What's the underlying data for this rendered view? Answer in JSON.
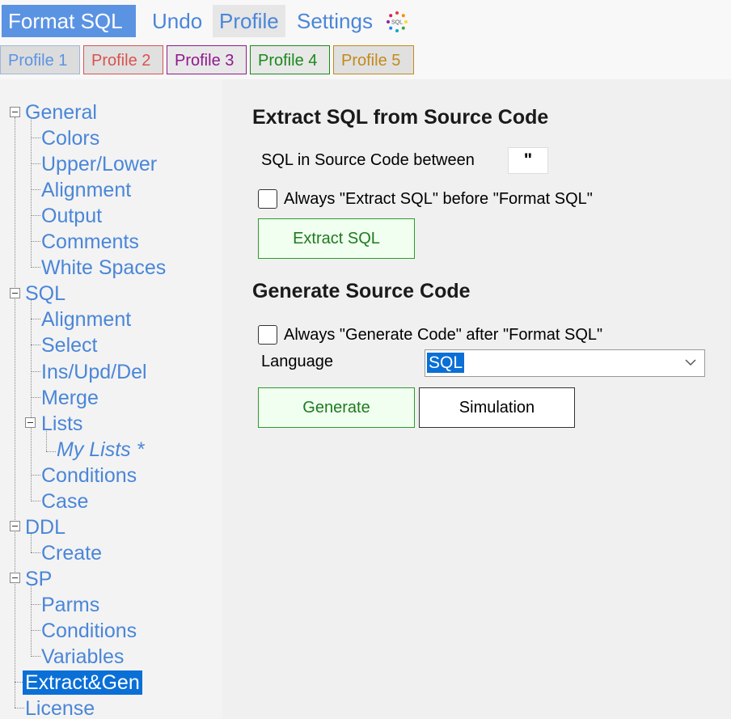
{
  "toolbar": {
    "format_sql": "Format SQL",
    "undo": "Undo",
    "profile": "Profile",
    "settings": "Settings",
    "logo_text": "SQL"
  },
  "profiles": [
    {
      "label": "Profile 1",
      "color": "#5b93e3",
      "bg": "#dcdcdc",
      "border": "#a0b8d8"
    },
    {
      "label": "Profile 2",
      "color": "#d9534f",
      "bg": "#e0e0e0",
      "border": "#d9534f"
    },
    {
      "label": "Profile 3",
      "color": "#8e1a8e",
      "bg": "#e8e8e8",
      "border": "#8e1a8e"
    },
    {
      "label": "Profile 4",
      "color": "#1a8a1a",
      "bg": "#e8e8e8",
      "border": "#1a8a1a"
    },
    {
      "label": "Profile 5",
      "color": "#c38a1a",
      "bg": "#e0e0e0",
      "border": "#c38a1a"
    }
  ],
  "tree": {
    "general": "General",
    "colors": "Colors",
    "upper_lower": "Upper/Lower",
    "alignment": "Alignment",
    "output": "Output",
    "comments": "Comments",
    "white_spaces": "White Spaces",
    "sql": "SQL",
    "sql_alignment": "Alignment",
    "select": "Select",
    "ins_upd_del": "Ins/Upd/Del",
    "merge": "Merge",
    "lists": "Lists",
    "my_lists": "My Lists *",
    "conditions": "Conditions",
    "case": "Case",
    "ddl": "DDL",
    "create": "Create",
    "sp": "SP",
    "parms": "Parms",
    "sp_conditions": "Conditions",
    "variables": "Variables",
    "extract_gen": "Extract&Gen",
    "license": "License"
  },
  "extract": {
    "heading": "Extract SQL from Source Code",
    "between_label": "SQL in Source Code between",
    "between_value": "\"",
    "always_extract": "Always \"Extract SQL\" before \"Format SQL\"",
    "always_extract_checked": false,
    "button": "Extract SQL"
  },
  "generate": {
    "heading": "Generate Source Code",
    "always_generate": "Always \"Generate Code\" after \"Format SQL\"",
    "always_generate_checked": false,
    "language_label": "Language",
    "language_value": "SQL",
    "generate_button": "Generate",
    "simulation_button": "Simulation"
  }
}
